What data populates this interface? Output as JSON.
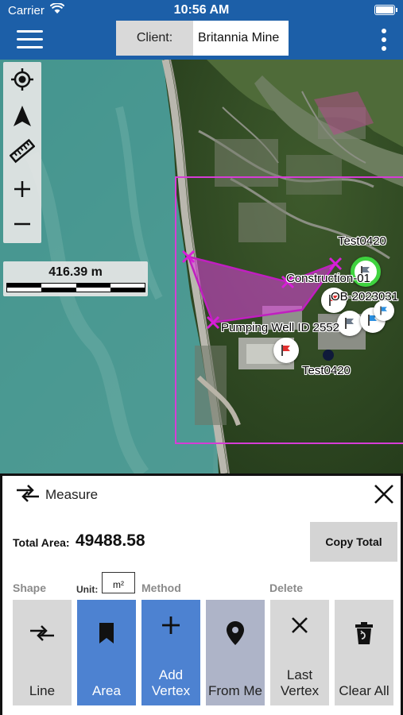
{
  "status_bar": {
    "carrier": "Carrier",
    "time": "10:56 AM"
  },
  "header": {
    "client_label": "Client:",
    "client_value": "Britannia Mine"
  },
  "map": {
    "scale_text": "416.39 m",
    "labels": {
      "test0420_top": "Test0420",
      "construction": "Construction-01",
      "ob": "OB-2023031",
      "pumping_well": "Pumping Well ID 2552",
      "test0420_bottom": "Test0420"
    },
    "tools": [
      "locate-icon",
      "north-arrow-icon",
      "ruler-icon",
      "zoom-in-icon",
      "zoom-out-icon"
    ]
  },
  "measure": {
    "title": "Measure",
    "total_label": "Total Area:",
    "total_value": "49488.58",
    "copy_label": "Copy Total",
    "shape_label": "Shape",
    "unit_label": "Unit:",
    "unit_value": "m²",
    "method_label": "Method",
    "delete_label": "Delete",
    "buttons": {
      "line": "Line",
      "area": "Area",
      "add_vertex": "Add\nVertex",
      "from_me": "From Me",
      "last_vertex": "Last\nVertex",
      "clear_all": "Clear All"
    }
  },
  "colors": {
    "header": "#1c5fa8",
    "accent_blue": "#4d82d1",
    "polygon": "#e040e0",
    "extent": "#d63cd6"
  }
}
